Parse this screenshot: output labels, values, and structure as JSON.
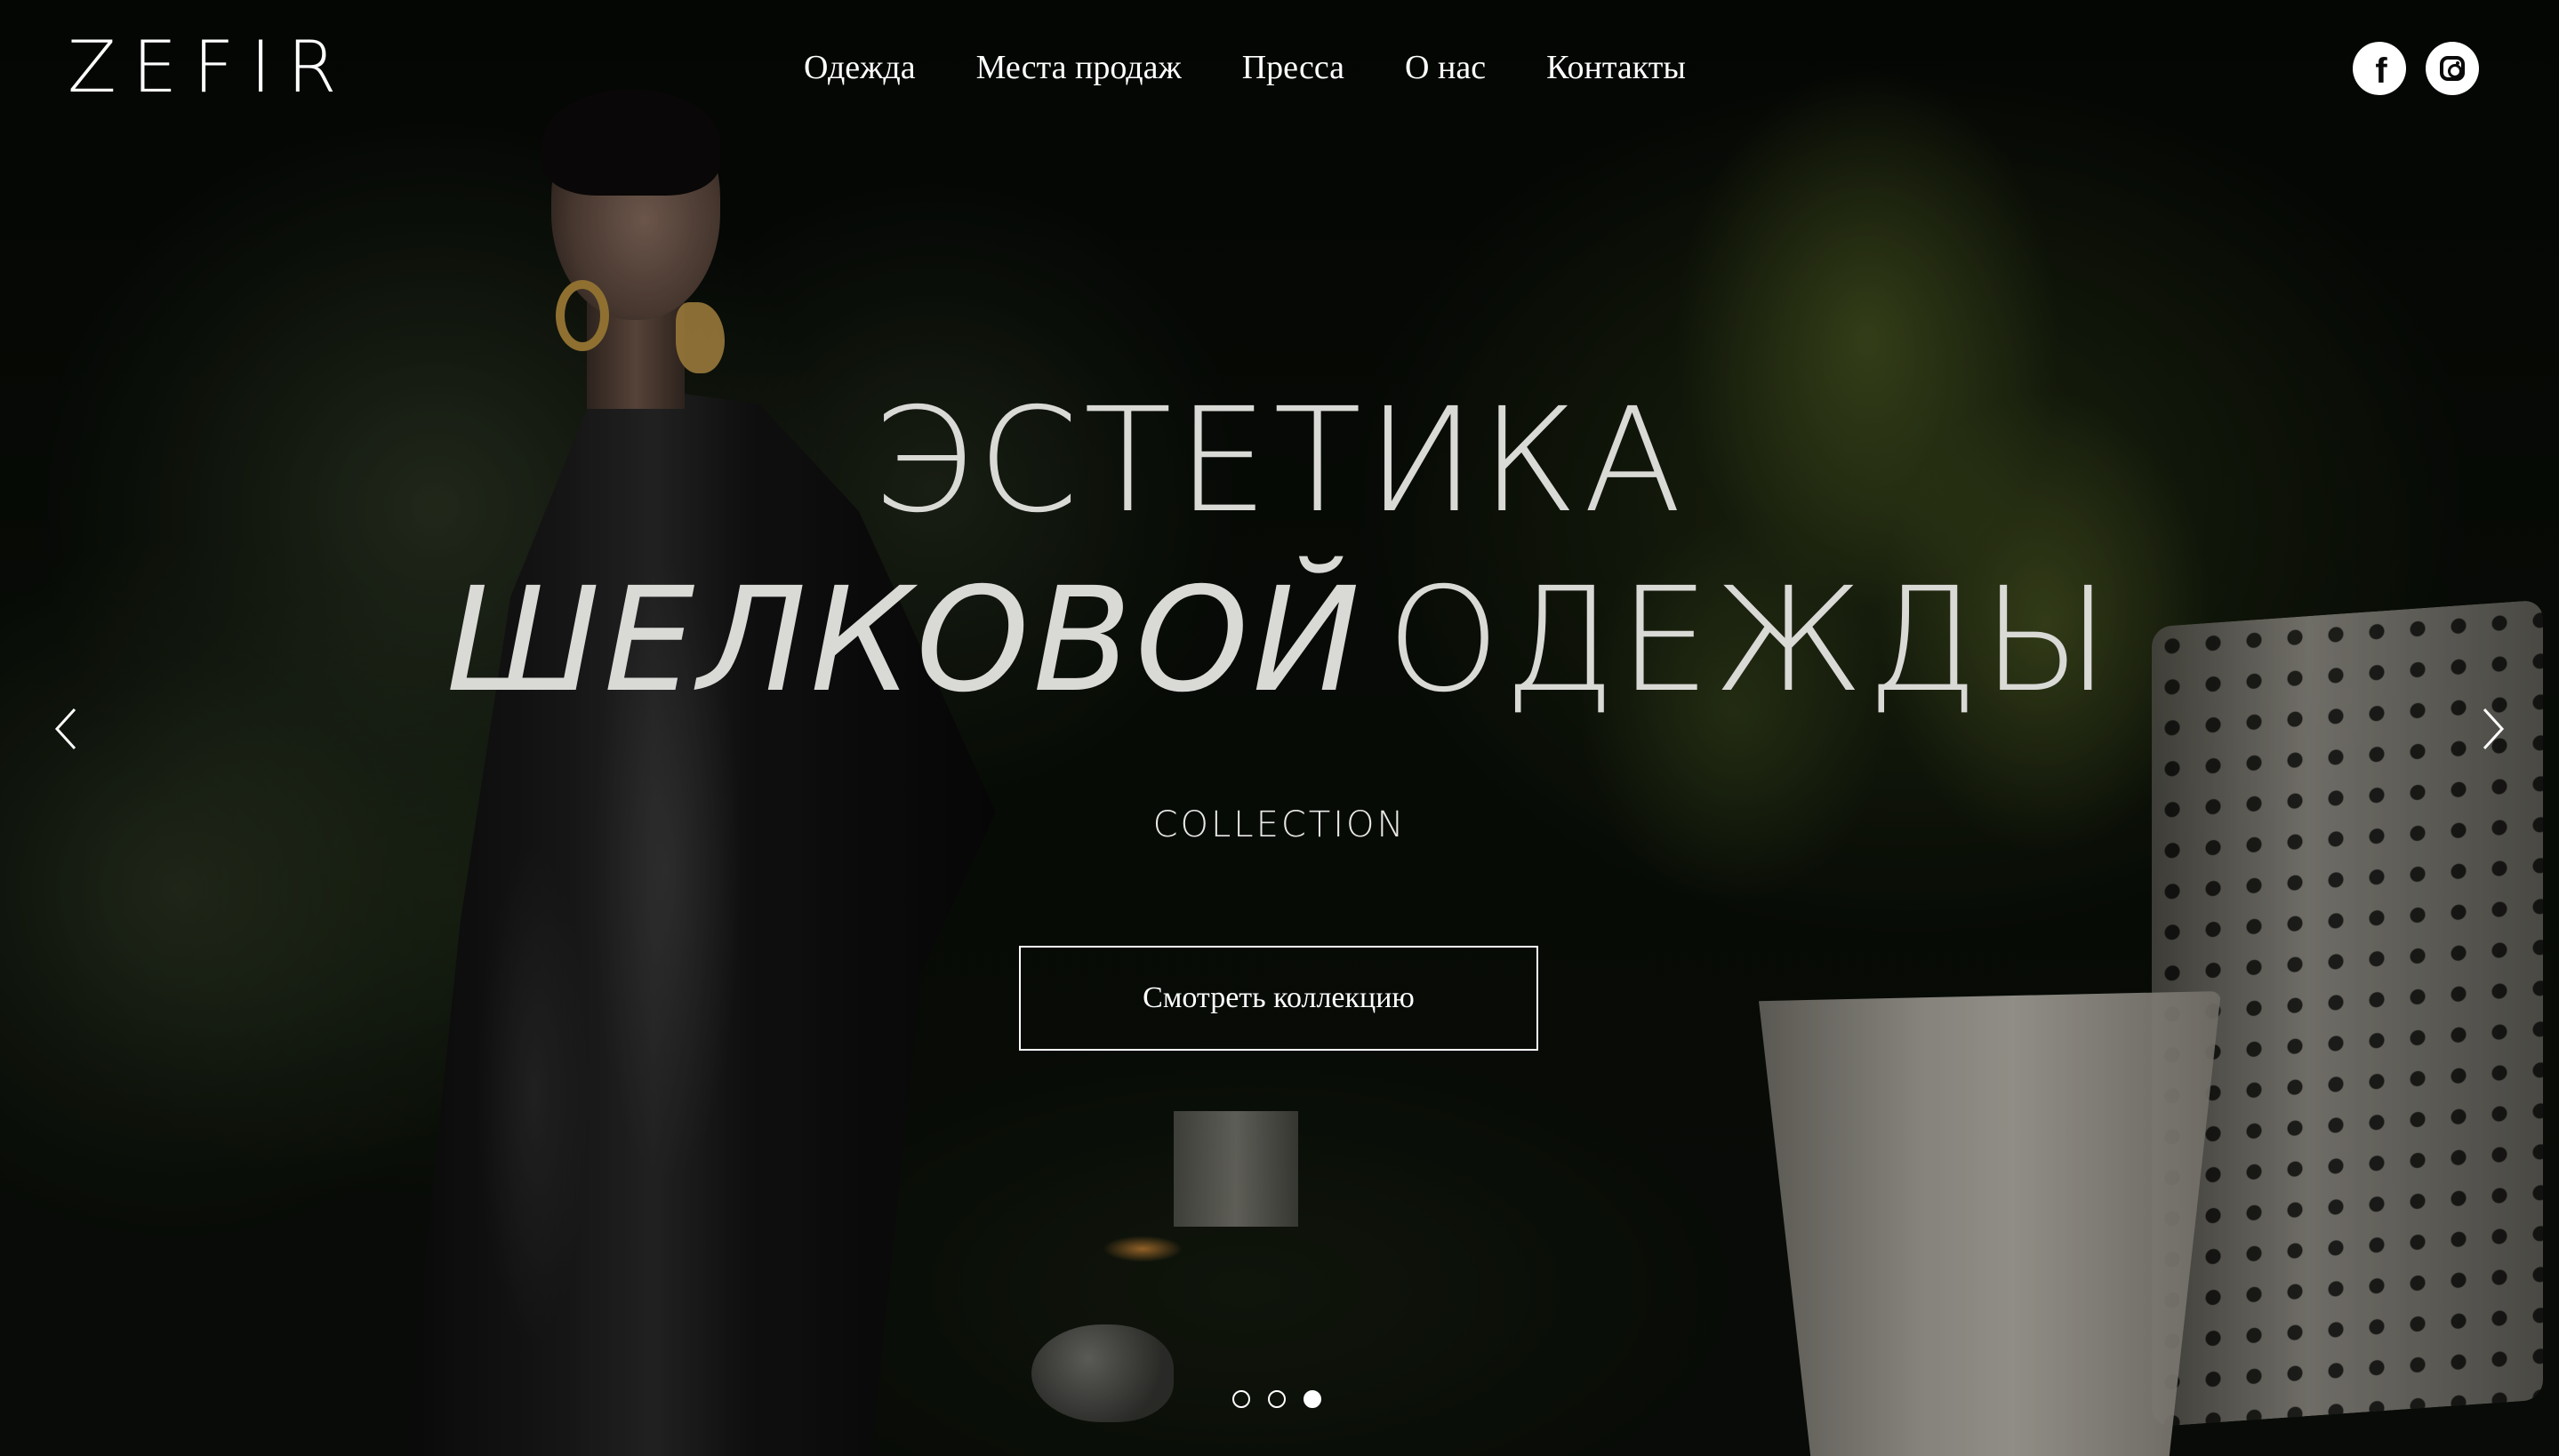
{
  "header": {
    "logo": "ZEFIR",
    "nav": [
      {
        "label": "Одежда"
      },
      {
        "label": "Места продаж"
      },
      {
        "label": "Пресса"
      },
      {
        "label": "О нас"
      },
      {
        "label": "Контакты"
      }
    ],
    "social": [
      {
        "icon": "facebook-icon"
      },
      {
        "icon": "instagram-icon"
      }
    ]
  },
  "hero": {
    "line1": "ЭСТЕТИКА",
    "line2_italic": "ШЕЛКОВОЙ",
    "line2_regular": "ОДЕЖДЫ",
    "subtitle": "COLLECTION",
    "cta_label": "Смотреть коллекцию"
  },
  "carousel": {
    "prev_icon": "chevron-left-icon",
    "next_icon": "chevron-right-icon",
    "slide_count": 3,
    "active_slide": 3
  },
  "colors": {
    "text": "#ffffff",
    "hero_text": "#d9d9d6",
    "background": "#070b06"
  }
}
